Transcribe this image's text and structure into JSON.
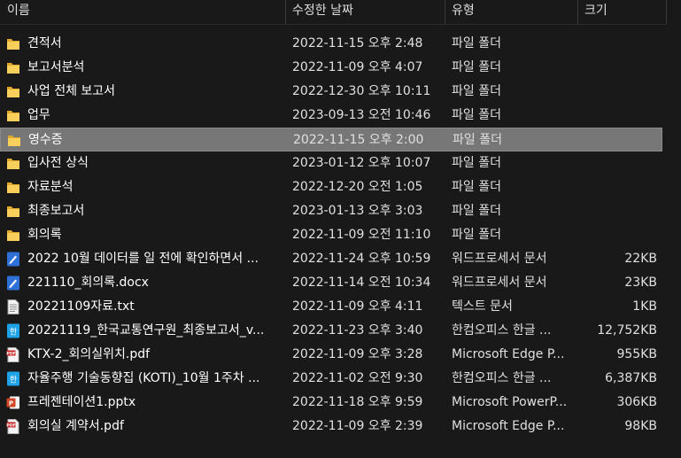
{
  "columns": {
    "name": "이름",
    "date": "수정한 날짜",
    "type": "유형",
    "size": "크기"
  },
  "colors": {
    "background": "#191919",
    "selected_row": "#777777",
    "folder": "#f2c744",
    "word": "#2b6fe0",
    "hwp": "#1aa0e6",
    "pdf": "#c91d1d",
    "pptx": "#d3461c"
  },
  "files": [
    {
      "icon": "folder-icon",
      "name": "견적서",
      "date": "2022-11-15 오후 2:48",
      "type": "파일 폴더",
      "size": ""
    },
    {
      "icon": "folder-icon",
      "name": "보고서분석",
      "date": "2022-11-09 오후 4:07",
      "type": "파일 폴더",
      "size": ""
    },
    {
      "icon": "folder-icon",
      "name": "사업 전체 보고서",
      "date": "2022-12-30 오후 10:11",
      "type": "파일 폴더",
      "size": ""
    },
    {
      "icon": "folder-icon",
      "name": "업무",
      "date": "2023-09-13 오전 10:46",
      "type": "파일 폴더",
      "size": ""
    },
    {
      "icon": "folder-icon",
      "name": "영수증",
      "date": "2022-11-15 오후 2:00",
      "type": "파일 폴더",
      "size": "",
      "selected": true
    },
    {
      "icon": "folder-icon",
      "name": "입사전 상식",
      "date": "2023-01-12 오후 10:07",
      "type": "파일 폴더",
      "size": ""
    },
    {
      "icon": "folder-icon",
      "name": "자료분석",
      "date": "2022-12-20 오전 1:05",
      "type": "파일 폴더",
      "size": ""
    },
    {
      "icon": "folder-icon",
      "name": "최종보고서",
      "date": "2023-01-13 오후 3:03",
      "type": "파일 폴더",
      "size": ""
    },
    {
      "icon": "folder-icon",
      "name": "회의록",
      "date": "2022-11-09 오전 11:10",
      "type": "파일 폴더",
      "size": ""
    },
    {
      "icon": "word-doc-icon",
      "name": "2022 10월 데이터를 일 전에 확인하면서 ...",
      "date": "2022-11-24 오후 10:59",
      "type": "워드프로세서 문서",
      "size": "22KB"
    },
    {
      "icon": "word-doc-icon",
      "name": "221110_회의록.docx",
      "date": "2022-11-14 오전 10:34",
      "type": "워드프로세서 문서",
      "size": "23KB"
    },
    {
      "icon": "text-file-icon",
      "name": "20221109자료.txt",
      "date": "2022-11-09 오후 4:11",
      "type": "텍스트 문서",
      "size": "1KB"
    },
    {
      "icon": "hwp-icon",
      "name": "20221119_한국교통연구원_최종보고서_v...",
      "date": "2022-11-23 오후 3:40",
      "type": "한컴오피스 한글 ...",
      "size": "12,752KB"
    },
    {
      "icon": "pdf-icon",
      "name": "KTX-2_회의실위치.pdf",
      "date": "2022-11-09 오후 3:28",
      "type": "Microsoft Edge P...",
      "size": "955KB"
    },
    {
      "icon": "hwp-icon",
      "name": "자율주행 기술동향집 (KOTI)_10월 1주차 ...",
      "date": "2022-11-02 오전 9:30",
      "type": "한컴오피스 한글 ...",
      "size": "6,387KB"
    },
    {
      "icon": "pptx-icon",
      "name": "프레젠테이션1.pptx",
      "date": "2022-11-18 오후 9:59",
      "type": "Microsoft PowerP...",
      "size": "306KB"
    },
    {
      "icon": "pdf-icon",
      "name": "회의실 계약서.pdf",
      "date": "2022-11-09 오후 2:39",
      "type": "Microsoft Edge P...",
      "size": "98KB"
    }
  ]
}
